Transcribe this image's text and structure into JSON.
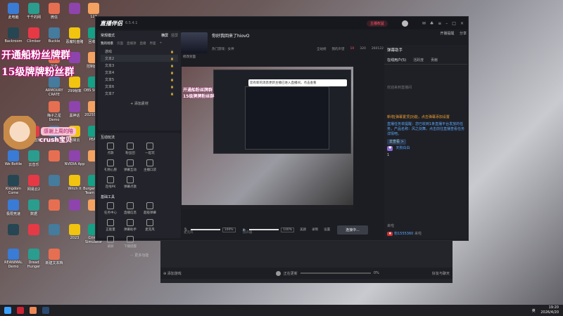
{
  "desktop": {
    "icons": [
      "此电脑",
      "千千的网",
      "微信",
      "",
      "123",
      "Backroom",
      "Climber",
      "Buckle",
      "恶魔轮盘赌",
      "回收站",
      "Steam",
      "斗鱼直播伴侣",
      "抖音",
      "",
      "控制面板",
      "MSI Afterburner",
      "腾讯QQ WeGame",
      "ARMOURY CRATE",
      "299帧率",
      "OBS Studio",
      "Wallpaper Engine",
      "QAQ",
      "梅子之星 Demo",
      "黑神话",
      "2025Smth",
      "DOME Rising",
      "一条直播",
      "直播",
      "网易云",
      "PEAK",
      "We Bottle",
      "云音乐",
      "",
      "NVIDIA App",
      "",
      "Kingdom Come",
      "网易云2",
      "",
      "Witch It",
      "Burger Shift Team Run",
      "极限竞速",
      "数据",
      "",
      "",
      "",
      "",
      "",
      "",
      "2023",
      "Crime Simulator",
      "REANIMAL Demo",
      "Dread Hunger",
      "新建文本档"
    ],
    "banner_line1": "开通船粉丝牌群",
    "banner_line2": "15级牌牌粉丝群",
    "sticker_text1": "感谢上周的陪",
    "sticker_text2": "crush宝贝"
  },
  "app": {
    "name": "直播伴侣",
    "version": "6.5.4.1",
    "open_live_button": "主播权益",
    "share_label": "分享",
    "live_open_label": "开播提醒",
    "stream_title": "你好我回来了hiovO",
    "edit_cover": "修改封面",
    "category": "热门游戏：女神",
    "room_stats": [
      "全站榜",
      "我的声望",
      "10",
      "320",
      "260122"
    ],
    "left_panel": {
      "mode": "常规模式",
      "tabs": [
        "横屏",
        "竖屏"
      ],
      "scene_tabs": [
        "我的场景",
        "页面",
        "直播源",
        "直播",
        "界面"
      ],
      "scenes": [
        "游戏",
        "文本2",
        "文本3",
        "文本4",
        "文本5",
        "文本6",
        "文本7"
      ],
      "add_source": "添加素材",
      "interaction_title": "互动玩法",
      "interactions": [
        "点歌",
        "粉丝团",
        "一起玩",
        "礼物心愿",
        "弹幕互动",
        "主播口袋",
        "连线PK",
        "弹幕点歌"
      ],
      "tools_title": "基础工具",
      "tools": [
        "任务中心",
        "直播信息",
        "超级弹幕",
        "正能量",
        "弹幕助手",
        "麦克风",
        "录屏",
        "下播提醒"
      ],
      "more_tools": "更多功能"
    },
    "bottom_bar": {
      "mic_label": "麦克风",
      "mic_value": "100%",
      "speaker_label": "扬声器",
      "speaker_value": "100%",
      "beauty": "美颜",
      "record": "录制",
      "settings": "设置",
      "start_button": "连接中...",
      "status_link": "如何快速上手直播伴侣",
      "stats": [
        "码率:0kb/s",
        "FPS:60",
        "丢帧:0.00%",
        "CPU:99%",
        "内存:52%"
      ]
    },
    "preview_popup": "您有新的消息更新主播已进入直播间，点击查看",
    "right_panel": {
      "title": "弹幕助手",
      "tabs": [
        "在线用户(5)",
        "活跃度",
        "贡献"
      ],
      "notices": [
        "欢迎来到直播间",
        "新增[弹幕置顶]功能，点击弹幕后可设置弹幕置顶",
        "您有1条新的公告，点击查看"
      ],
      "highlight_1": "新增[弹幕置顶]功能，点击弹幕添加设置",
      "highlight_2": "直播任务单提醒：您已收到1条直播平台发放的任务，产品名称：风之剑舞。点击前往直播查看任务详情吧。",
      "view_button": "去查看 >",
      "badge_user": "天狗白白",
      "count": "1",
      "online_text": "来啦",
      "bottom_user": "粉1555360",
      "bottom_action": "来啦"
    }
  },
  "win2": {
    "add_game": "添加游戏",
    "update_label": "正在更新",
    "progress": 0,
    "progress_text": "0%",
    "friends": "好友与聊天"
  },
  "taskbar": {
    "time": "19:20",
    "date": "2026/4/20",
    "lang": "英"
  }
}
